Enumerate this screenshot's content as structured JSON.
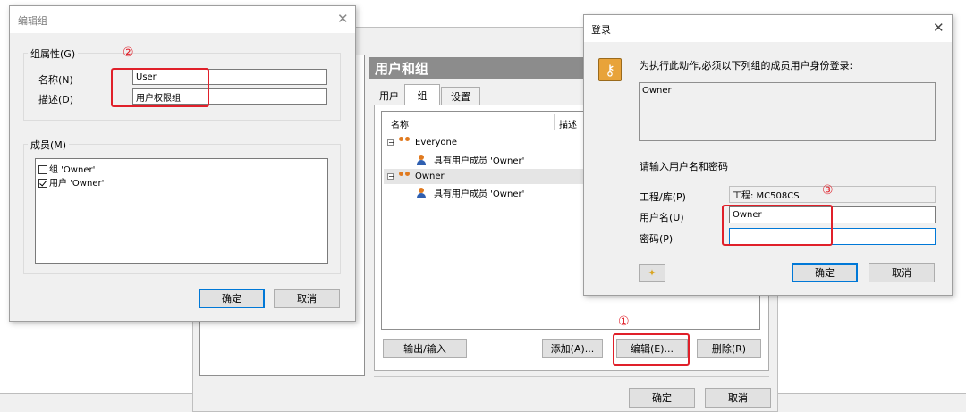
{
  "edit_group": {
    "title": "编辑组",
    "properties_label": "组属性(G)",
    "name_label": "名称(N)",
    "name_value": "User",
    "desc_label": "描述(D)",
    "desc_value": "用户权限组",
    "members_label": "成员(M)",
    "members": [
      {
        "text": "组 'Owner'",
        "checked": false
      },
      {
        "text": "用户 'Owner'",
        "checked": true
      }
    ],
    "ok_label": "确定",
    "cancel_label": "取消",
    "annotation": "②"
  },
  "users_groups": {
    "title": "用户和组",
    "tabs": [
      "用户",
      "组",
      "设置"
    ],
    "col_name": "名称",
    "col_desc": "描述",
    "tree": [
      {
        "label": "Everyone",
        "child": "具有用户成员 'Owner'"
      },
      {
        "label": "Owner",
        "child": "具有用户成员 'Owner'"
      }
    ],
    "export_label": "输出/输入",
    "add_label": "添加(A)...",
    "edit_label": "编辑(E)...",
    "delete_label": "删除(R)",
    "ok_label": "确定",
    "cancel_label": "取消",
    "annotation": "①"
  },
  "login": {
    "title": "登录",
    "message": "为执行此动作,必须以下列组的成员用户身份登录:",
    "group_list": "Owner",
    "prompt": "请输入用户名和密码",
    "project_label": "工程/库(P)",
    "project_value": "工程: MC508CS",
    "user_label": "用户名(U)",
    "user_value": "Owner",
    "password_label": "密码(P)",
    "password_value": "",
    "ok_label": "确定",
    "cancel_label": "取消",
    "annotation": "③"
  }
}
